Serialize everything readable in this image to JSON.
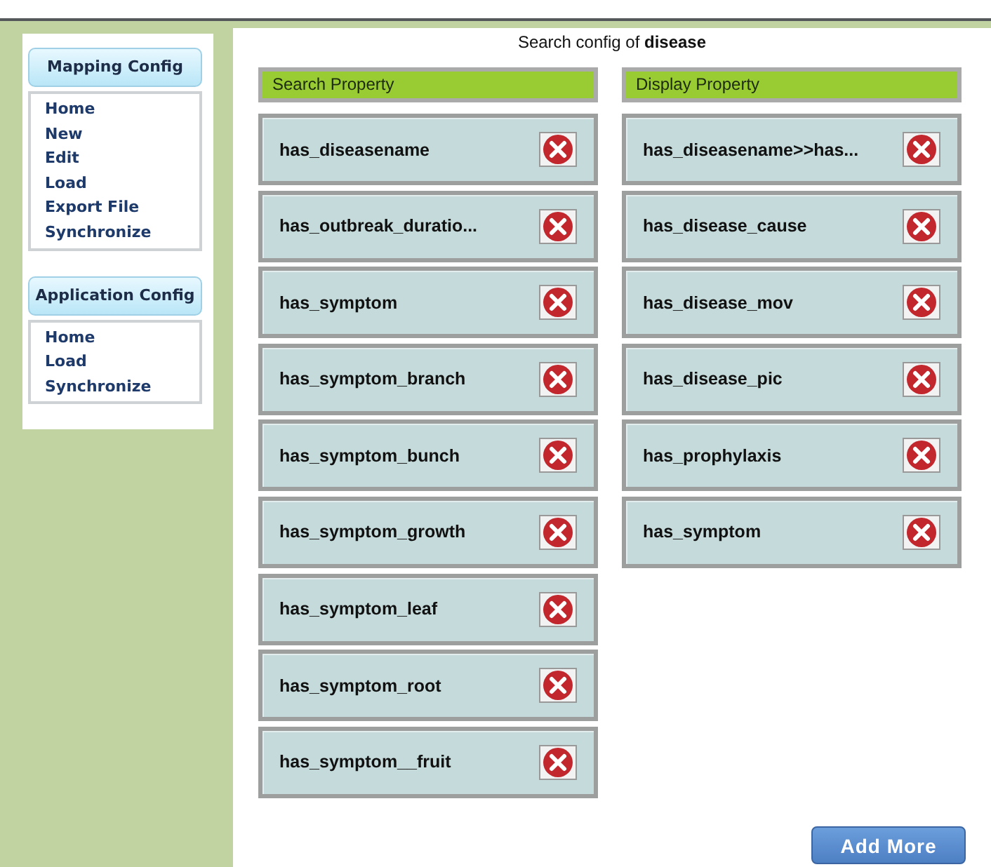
{
  "sidebar": {
    "sections": [
      {
        "title": "Mapping Config",
        "items": [
          "Home",
          "New",
          "Edit",
          "Load",
          "Export File",
          "Synchronize"
        ]
      },
      {
        "title": "Application Config",
        "items": [
          "Home",
          "Load",
          "Synchronize"
        ]
      }
    ]
  },
  "main": {
    "title": "Search config of **disease**",
    "columns": [
      {
        "header": "Search Property",
        "items": [
          "has_diseasename",
          "has_outbreak_duratio...",
          "has_symptom",
          "has_symptom_branch",
          "has_symptom_bunch",
          "has_symptom_growth",
          "has_symptom_leaf",
          "has_symptom_root",
          "has_symptom__fruit"
        ]
      },
      {
        "header": "Display Property",
        "items": [
          "has_diseasename>>has...",
          "has_disease_cause",
          "has_disease_mov",
          "has_disease_pic",
          "has_prophylaxis",
          "has_symptom"
        ]
      }
    ],
    "add_button": "Add More"
  }
}
